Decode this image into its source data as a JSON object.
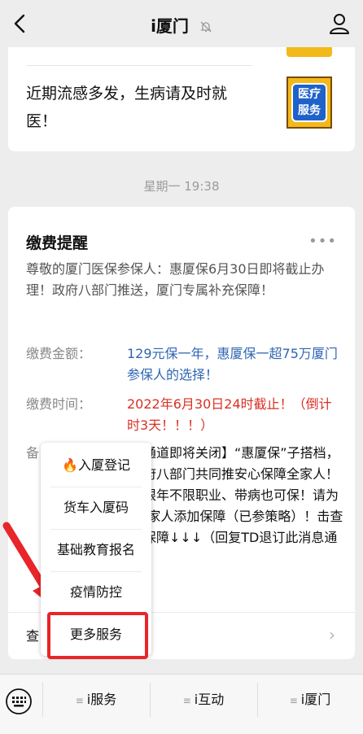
{
  "header": {
    "title": "i厦门"
  },
  "news": {
    "text": "近期流感多发，生病请及时就医！",
    "thumb_label_1": "医疗",
    "thumb_label_2": "服务"
  },
  "timestamp": "星期一 19:38",
  "message": {
    "title": "缴费提醒",
    "more": "•••",
    "intro": "尊敬的厦门医保参保人：惠厦保6月30日即将截止办理！政府八部门推送，厦门专属补充保障！",
    "amount_label": "缴费金额：",
    "amount_value": "129元保一年，惠厦保一超75万厦门参保人的选择！",
    "time_label": "缴费时间：",
    "time_value": "2022年6月30日24时截止！（倒计时3天！！！）",
    "remark_label": "备",
    "remark_value": "保通道即将关闭】“惠厦保”子搭档，政府八部门共同推安心保障全家人！不限年不限职业、带病也可保！请为您/家人添加保障（已参策略）！击查看保障↓↓↓（回复TD退订此消息通知）",
    "view_label": "查",
    "chevron": "›"
  },
  "popup_menu": {
    "items": [
      "🔥入厦登记",
      "货车入厦码",
      "基础教育报名",
      "疫情防控",
      "更多服务"
    ]
  },
  "tabbar": {
    "tabs": [
      "i服务",
      "i互动",
      "i厦门"
    ],
    "tab_prefix": "≡"
  },
  "colors": {
    "accent_red": "#e8252a",
    "link_blue": "#2f66b2",
    "warn_red": "#d93025"
  }
}
